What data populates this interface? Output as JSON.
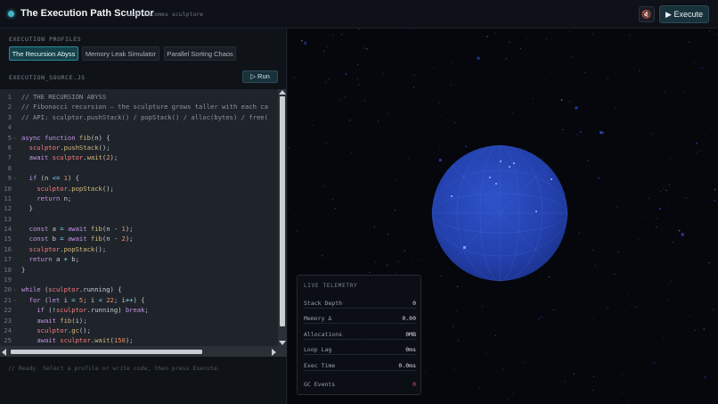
{
  "header": {
    "title": "The Execution Path Sculptor",
    "subtitle": "code becomes sculpture",
    "mute_icon": "🔇",
    "execute_label": "▶ Execute"
  },
  "profiles": {
    "section_label": "EXECUTION PROFILES",
    "tabs": [
      {
        "label": "The Recursion Abyss",
        "active": true
      },
      {
        "label": "Memory Leak Simulator",
        "active": false
      },
      {
        "label": "Parallel Sorting Chaos",
        "active": false
      }
    ]
  },
  "editor": {
    "filename": "EXECUTION_SOURCE.JS",
    "run_label": "▷ Run",
    "lines": [
      {
        "n": "1",
        "fold": false,
        "html": "<span class=\"c-cm\">// THE RECURSION ABYSS</span>"
      },
      {
        "n": "2",
        "fold": false,
        "html": "<span class=\"c-cm\">// Fibonacci recursion — the sculpture grows taller with each ca</span>"
      },
      {
        "n": "3",
        "fold": false,
        "html": "<span class=\"c-cm\">// API: sculptor.pushStack() / popStack() / alloc(bytes) / free(</span>"
      },
      {
        "n": "4",
        "fold": false,
        "html": ""
      },
      {
        "n": "5",
        "fold": true,
        "html": "<span class=\"c-kw\">async function</span> <span class=\"c-fn\">fib</span>(n) {"
      },
      {
        "n": "6",
        "fold": false,
        "html": "  <span class=\"c-var\">sculptor</span>.<span class=\"c-fn\">pushStack</span>();"
      },
      {
        "n": "7",
        "fold": false,
        "html": "  <span class=\"c-kw\">await</span> <span class=\"c-var\">sculptor</span>.<span class=\"c-fn\">wait</span>(<span class=\"c-num\">2</span>);"
      },
      {
        "n": "8",
        "fold": false,
        "html": ""
      },
      {
        "n": "9",
        "fold": true,
        "html": "  <span class=\"c-kw\">if</span> (n <span class=\"c-op\">&lt;=</span> <span class=\"c-num\">1</span>) {"
      },
      {
        "n": "10",
        "fold": false,
        "html": "    <span class=\"c-var\">sculptor</span>.<span class=\"c-fn\">popStack</span>();"
      },
      {
        "n": "11",
        "fold": false,
        "html": "    <span class=\"c-kw\">return</span> n;"
      },
      {
        "n": "12",
        "fold": false,
        "html": "  }"
      },
      {
        "n": "13",
        "fold": false,
        "html": ""
      },
      {
        "n": "14",
        "fold": false,
        "html": "  <span class=\"c-kw\">const</span> a <span class=\"c-op\">=</span> <span class=\"c-kw\">await</span> <span class=\"c-fn\">fib</span>(n <span class=\"c-op\">-</span> <span class=\"c-num\">1</span>);"
      },
      {
        "n": "15",
        "fold": false,
        "html": "  <span class=\"c-kw\">const</span> b <span class=\"c-op\">=</span> <span class=\"c-kw\">await</span> <span class=\"c-fn\">fib</span>(n <span class=\"c-op\">-</span> <span class=\"c-num\">2</span>);"
      },
      {
        "n": "16",
        "fold": false,
        "html": "  <span class=\"c-var\">sculptor</span>.<span class=\"c-fn\">popStack</span>();"
      },
      {
        "n": "17",
        "fold": false,
        "html": "  <span class=\"c-kw\">return</span> a <span class=\"c-op\">+</span> b;"
      },
      {
        "n": "18",
        "fold": false,
        "html": "}"
      },
      {
        "n": "19",
        "fold": false,
        "html": ""
      },
      {
        "n": "20",
        "fold": true,
        "html": "<span class=\"c-kw\">while</span> (<span class=\"c-var\">sculptor</span>.running) {"
      },
      {
        "n": "21",
        "fold": true,
        "html": "  <span class=\"c-kw\">for</span> (<span class=\"c-kw\">let</span> i <span class=\"c-op\">=</span> <span class=\"c-num\">5</span>; i <span class=\"c-op\">&lt;</span> <span class=\"c-num\">22</span>; i<span class=\"c-op\">++</span>) {"
      },
      {
        "n": "22",
        "fold": false,
        "html": "    <span class=\"c-kw\">if</span> (<span class=\"c-op\">!</span><span class=\"c-var\">sculptor</span>.running) <span class=\"c-kw\">break</span>;"
      },
      {
        "n": "23",
        "fold": false,
        "html": "    <span class=\"c-kw\">await</span> <span class=\"c-fn\">fib</span>(i);"
      },
      {
        "n": "24",
        "fold": false,
        "html": "    <span class=\"c-var\">sculptor</span>.<span class=\"c-fn\">gc</span>();"
      },
      {
        "n": "25",
        "fold": false,
        "html": "    <span class=\"c-kw\">await</span> <span class=\"c-var\">sculptor</span>.<span class=\"c-fn\">wait</span>(<span class=\"c-num\">150</span>);"
      }
    ]
  },
  "console": {
    "message": "// Ready. Select a profile or write code, then press Execute."
  },
  "telemetry": {
    "title": "LIVE TELEMETRY",
    "rows": [
      {
        "label": "Stack Depth",
        "value": "0",
        "alert": false
      },
      {
        "label": "Memory Δ",
        "value": "0.00",
        "alert": false
      },
      {
        "label": "Allocations",
        "value": "0MB",
        "alert": false
      },
      {
        "label": "Loop Lag",
        "value": "0ms",
        "alert": false
      },
      {
        "label": "Exec Time",
        "value": "0.0ms",
        "alert": false
      },
      {
        "label": "GC Events",
        "value": "0",
        "alert": true
      }
    ]
  },
  "colors": {
    "accent": "#3fb6c8",
    "sphere": "#2643b3",
    "alert": "#e2564f"
  }
}
